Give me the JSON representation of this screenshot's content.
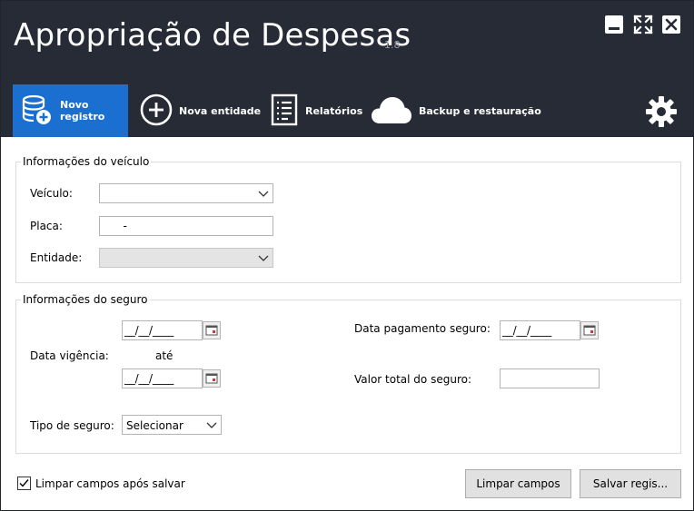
{
  "header": {
    "title": "Apropriação de Despesas",
    "version": "1.8"
  },
  "window_controls": {
    "minimize_icon": "minimize-icon",
    "fullscreen_icon": "fullscreen-icon",
    "close_icon": "close-icon"
  },
  "toolbar": {
    "items": [
      {
        "label": "Novo registro",
        "icon": "database-add-icon",
        "active": true
      },
      {
        "label": "Nova entidade",
        "icon": "plus-circle-icon",
        "active": false
      },
      {
        "label": "Relatórios",
        "icon": "report-icon",
        "active": false
      },
      {
        "label": "Backup e restauração",
        "icon": "cloud-icon",
        "active": false
      }
    ],
    "settings_icon": "gear-icon"
  },
  "veiculo": {
    "group_title": "Informações do veículo",
    "veiculo_label": "Veículo:",
    "veiculo_value": "",
    "placa_label": "Placa:",
    "placa_value": "   -",
    "entidade_label": "Entidade:",
    "entidade_value": ""
  },
  "seguro": {
    "group_title": "Informações do seguro",
    "data_vigencia_label": "Data vigência:",
    "ate_label": "até",
    "vigencia_inicio": "__/__/____",
    "vigencia_fim": "__/__/____",
    "data_pagamento_label": "Data pagamento seguro:",
    "data_pagamento": "__/__/____",
    "valor_total_label": "Valor total do seguro:",
    "valor_total": "",
    "tipo_label": "Tipo de seguro:",
    "tipo_value": "Selecionar"
  },
  "footer": {
    "limpar_apos_salvar_label": "Limpar campos após salvar",
    "limpar_apos_salvar_checked": true,
    "limpar_button": "Limpar campos",
    "salvar_button": "Salvar regis..."
  },
  "colors": {
    "header_bg": "#262b35",
    "accent": "#1a6fd0"
  }
}
